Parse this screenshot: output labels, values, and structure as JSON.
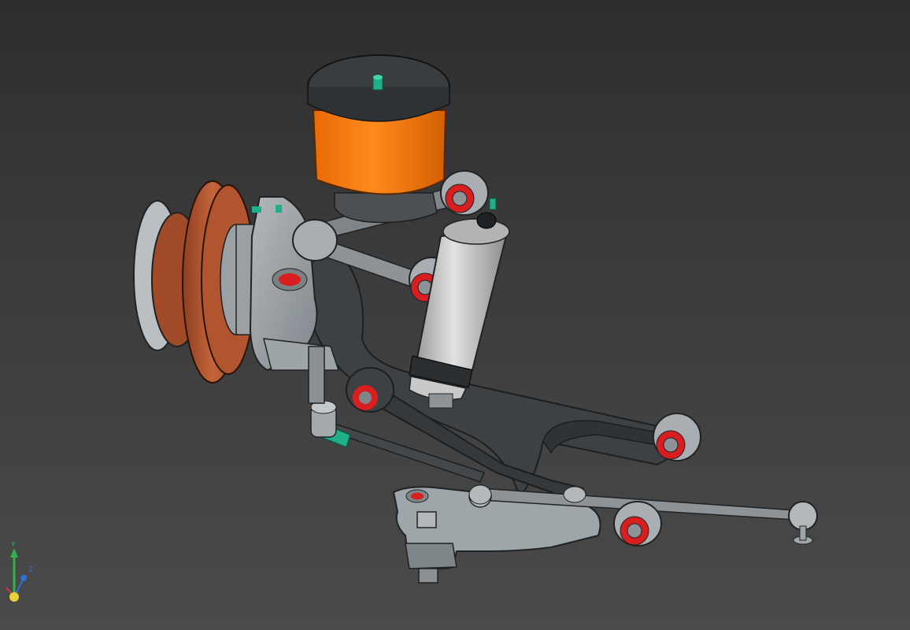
{
  "viewer": {
    "background_top": "#2e2e2e",
    "background_bottom": "#4a4a4a"
  },
  "model": {
    "parts": [
      {
        "name": "air-spring",
        "color": "#f2760d"
      },
      {
        "name": "air-spring-cap",
        "color": "#3a3d40"
      },
      {
        "name": "brake-disc",
        "color": "#b85a33"
      },
      {
        "name": "hub",
        "color": "#9aa0a4"
      },
      {
        "name": "upright",
        "color": "#8e969b"
      },
      {
        "name": "shock-absorber",
        "color": "#c8c8c8"
      },
      {
        "name": "lower-control-arm",
        "color": "#3d4144"
      },
      {
        "name": "upper-links",
        "color": "#909599"
      },
      {
        "name": "bushing-inserts",
        "color": "#d81e1e"
      },
      {
        "name": "fittings",
        "color": "#20b089"
      }
    ]
  },
  "axis_triad": {
    "labels": {
      "y": "Y",
      "z": "Z"
    },
    "colors": {
      "x": "#d23b3b",
      "y": "#2fb34a",
      "z": "#2f6fd6",
      "origin": "#e8d23a"
    }
  }
}
